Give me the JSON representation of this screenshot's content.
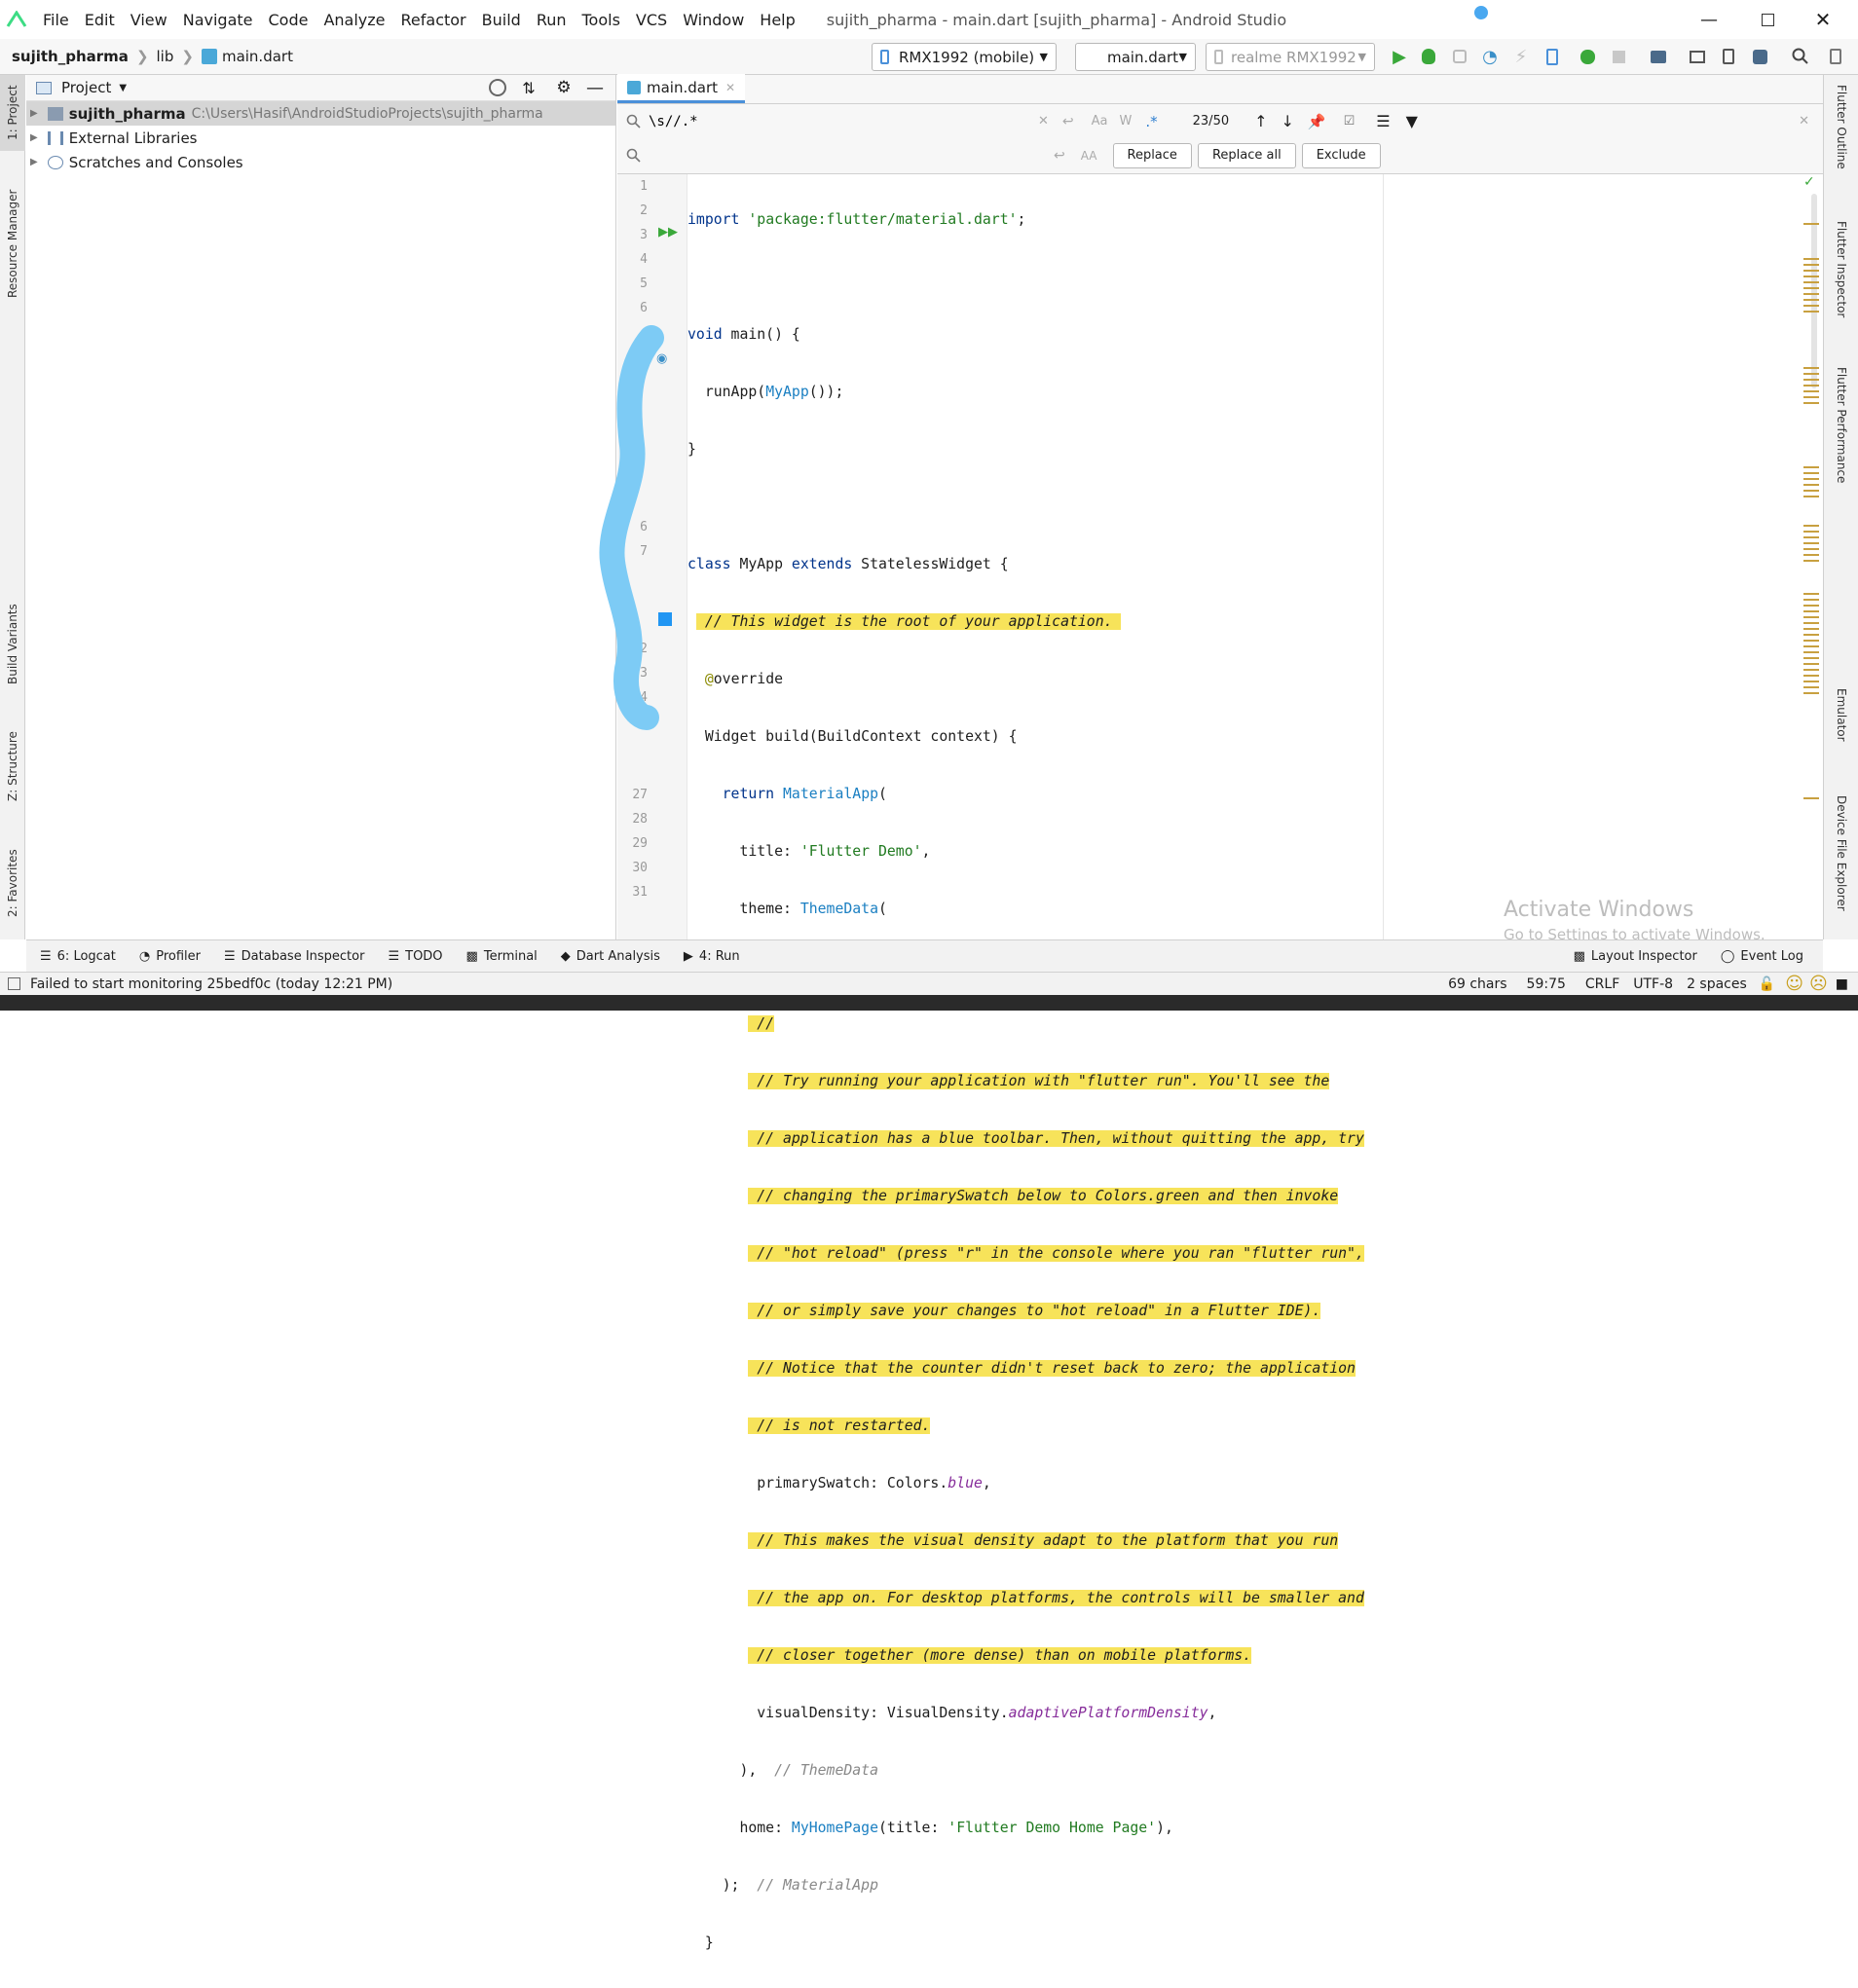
{
  "titlebar": {
    "menu": [
      "File",
      "Edit",
      "View",
      "Navigate",
      "Code",
      "Analyze",
      "Refactor",
      "Build",
      "Run",
      "Tools",
      "VCS",
      "Window",
      "Help"
    ],
    "window_title": "sujith_pharma - main.dart [sujith_pharma] - Android Studio"
  },
  "navbar": {
    "breadcrumb": [
      "sujith_pharma",
      "lib",
      "main.dart"
    ],
    "device": "RMX1992 (mobile)",
    "config": "main.dart",
    "run_device": "realme RMX1992"
  },
  "left_tabs": [
    "1: Project",
    "Resource Manager",
    "Build Variants",
    "Z: Structure",
    "2: Favorites"
  ],
  "right_tabs": [
    "Flutter Outline",
    "Flutter Inspector",
    "Flutter Performance",
    "Emulator",
    "Device File Explorer"
  ],
  "project": {
    "title": "Project",
    "items": [
      {
        "name": "sujith_pharma",
        "path": "C:\\Users\\Hasif\\AndroidStudioProjects\\sujith_pharma"
      },
      {
        "name": "External Libraries",
        "path": ""
      },
      {
        "name": "Scratches and Consoles",
        "path": ""
      }
    ]
  },
  "editor": {
    "tab": "main.dart",
    "find": {
      "query": "\\s//.*",
      "replace_value": "",
      "count": "23/50",
      "replace_label": "Replace",
      "replace_all_label": "Replace all",
      "exclude_label": "Exclude"
    },
    "line_numbers": [
      "1",
      "2",
      "3",
      "4",
      "5",
      "6",
      "",
      "",
      "",
      "",
      "",
      "",
      "",
      "",
      "6",
      "7",
      "",
      "",
      "",
      "2",
      "3",
      "4",
      "",
      "",
      "",
      "27",
      "28",
      "29",
      "30",
      "31"
    ]
  },
  "bottom_tabs": [
    "6: Logcat",
    "Profiler",
    "Database Inspector",
    "TODO",
    "Terminal",
    "Dart Analysis",
    "4: Run",
    "Layout Inspector",
    "Event Log"
  ],
  "watermark": {
    "line1": "Activate Windows",
    "line2": "Go to Settings to activate Windows."
  },
  "status": {
    "message": "Failed to start monitoring 25bedf0c (today 12:21 PM)",
    "chars": "69 chars",
    "position": "59:75",
    "line_sep": "CRLF",
    "encoding": "UTF-8",
    "indent": "2 spaces"
  },
  "colors": {
    "highlight": "#f7e35a",
    "accent": "#4a90d9",
    "android_green": "#3ddc84",
    "annotation": "#7dcbf5"
  }
}
